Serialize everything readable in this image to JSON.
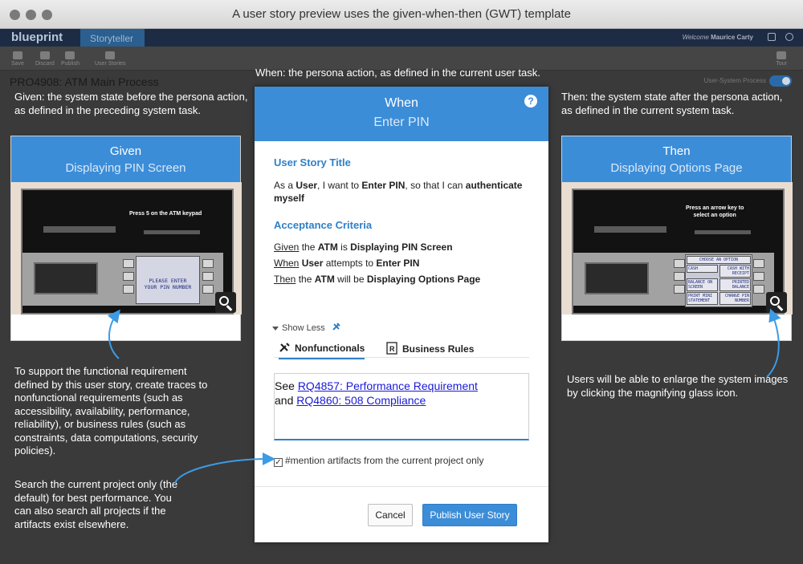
{
  "window": {
    "title": "A user story preview uses the given-when-then (GWT) template"
  },
  "app": {
    "logo": "blueprint",
    "tab": "Storyteller",
    "welcome_prefix": "Welcome",
    "user": "Maurice Carty",
    "toolbar": [
      "Save",
      "Discard",
      "Publish",
      "User Stories"
    ],
    "toolbar_right": "Tour",
    "process_title": "PRO4908: ATM Main Process",
    "toggle_label": "User-System Process"
  },
  "annotations": {
    "when": "When: the persona action, as defined in the current user task.",
    "given": "Given: the system state before the persona action, as defined in the preceding system task.",
    "then": "Then: the system state after the persona action, as defined in the current system task.",
    "traces": "To support the functional requirement defined by this user story, create traces to nonfunctional requirements (such as accessibility, availability, performance, reliability), or business rules (such as constraints, data computations, security policies).",
    "search": "Search the current project only (the default) for best performance. You can also search all projects if the artifacts exist elsewhere.",
    "enlarge": "Users will be able to enlarge the system images by clicking the magnifying glass icon."
  },
  "given_card": {
    "label": "Given",
    "state": "Displaying PIN Screen",
    "atm_prompt": "Press 5 on the ATM keypad",
    "screen_line1": "PLEASE ENTER",
    "screen_line2": "YOUR PIN NUMBER"
  },
  "then_card": {
    "label": "Then",
    "state": "Displaying Options Page",
    "atm_prompt_1": "Press an arrow key to",
    "atm_prompt_2": "select an option",
    "menu_title": "CHOOSE AN OPTION",
    "options": [
      "CASH",
      "CASH WITH RECEIPT",
      "BALANCE ON SCREEN",
      "PRINTED BALANCE",
      "PRINT MINI STATEMENT",
      "CHANGE PIN NUMBER"
    ]
  },
  "modal": {
    "label": "When",
    "action": "Enter PIN",
    "help": "?",
    "story_title_heading": "User Story Title",
    "story": {
      "p1": "As a ",
      "b1": "User",
      "p2": ", I want to ",
      "b2": "Enter PIN",
      "p3": ", so that I can ",
      "b3": "authenticate myself"
    },
    "criteria_heading": "Acceptance Criteria",
    "criteria": [
      {
        "kw": "Given",
        "t1": " the ",
        "b1": "ATM",
        "t2": " is ",
        "b2": "Displaying PIN Screen"
      },
      {
        "kw": "When",
        "t1": " ",
        "b1": "User",
        "t2": " attempts to ",
        "b2": "Enter PIN"
      },
      {
        "kw": "Then",
        "t1": " the ",
        "b1": "ATM",
        "t2": " will be ",
        "b2": "Displaying Options Page"
      }
    ],
    "show_less": "Show Less",
    "tabs": [
      "Nonfunctionals",
      "Business Rules"
    ],
    "editor": {
      "see": "See ",
      "link1": "RQ4857: Performance Requirement",
      "and": "and ",
      "link2": "RQ4860: 508 Compliance"
    },
    "checkbox_label": "#mention artifacts from the current project only",
    "cancel": "Cancel",
    "publish": "Publish User Story"
  },
  "colors": {
    "accent": "#3c8dd8",
    "overlay": "#3a3a3a",
    "link": "#1a1ad8"
  }
}
